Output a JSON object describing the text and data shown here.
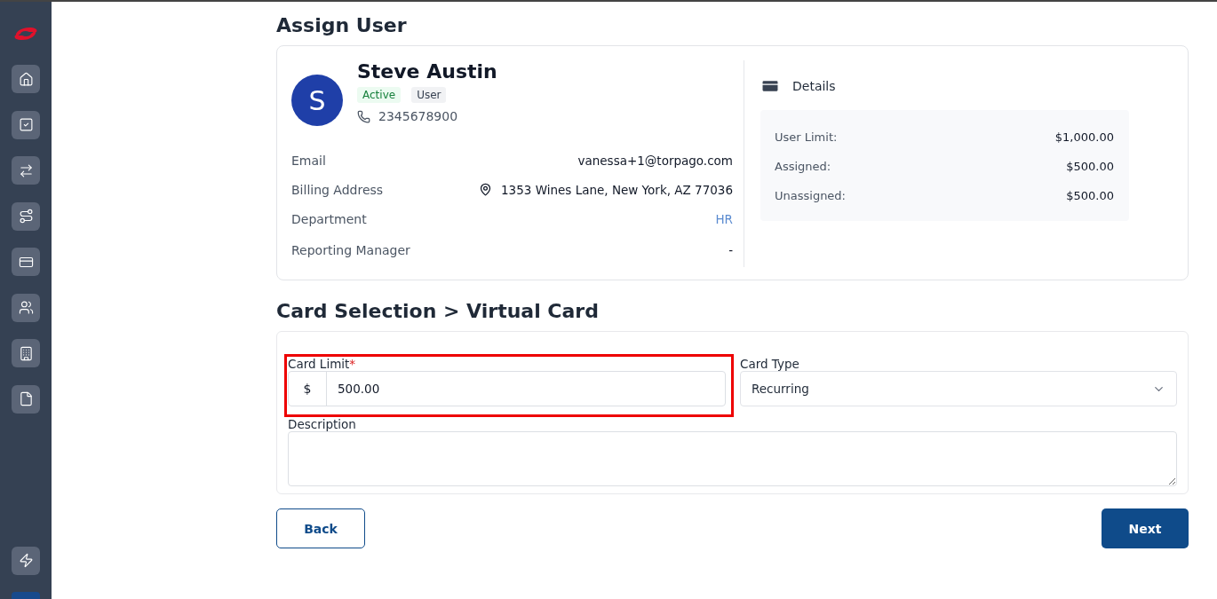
{
  "sidebar": {
    "items": [
      {
        "kind": "home",
        "selected": false
      },
      {
        "kind": "check",
        "selected": false
      },
      {
        "kind": "transfer",
        "selected": false
      },
      {
        "kind": "route",
        "selected": false
      },
      {
        "kind": "card",
        "selected": false
      },
      {
        "kind": "users",
        "selected": false
      },
      {
        "kind": "building",
        "selected": false
      },
      {
        "kind": "file",
        "selected": false
      }
    ],
    "bottom_items": [
      {
        "kind": "bolt",
        "selected": false
      }
    ]
  },
  "assign_title": "Assign User",
  "user": {
    "initial": "S",
    "name": "Steve Austin",
    "status": "Active",
    "role": "User",
    "phone": "2345678900"
  },
  "user_fields": [
    {
      "label": "Email",
      "value": "vanessa+1@torpago.com",
      "kind": "text"
    },
    {
      "label": "Billing Address",
      "value": "1353 Wines Lane, New York, AZ 77036",
      "kind": "address"
    },
    {
      "label": "Department",
      "value": "HR",
      "kind": "link"
    },
    {
      "label": "Reporting Manager",
      "value": "-",
      "kind": "text"
    }
  ],
  "details": {
    "title": "Details",
    "rows": [
      {
        "label": "User Limit:",
        "value": "$1,000.00"
      },
      {
        "label": "Assigned:",
        "value": "$500.00"
      },
      {
        "label": "Unassigned:",
        "value": "$500.00"
      }
    ]
  },
  "card_title": "Card Selection > Virtual Card",
  "form": {
    "card_limit": {
      "label": "Card Limit",
      "required_mark": "*",
      "prefix": "$",
      "value": "500.00",
      "highlighted": true
    },
    "card_type": {
      "label": "Card Type",
      "value": "Recurring"
    },
    "description": {
      "label": "Description"
    }
  },
  "buttons": {
    "back": "Back",
    "next": "Next"
  }
}
